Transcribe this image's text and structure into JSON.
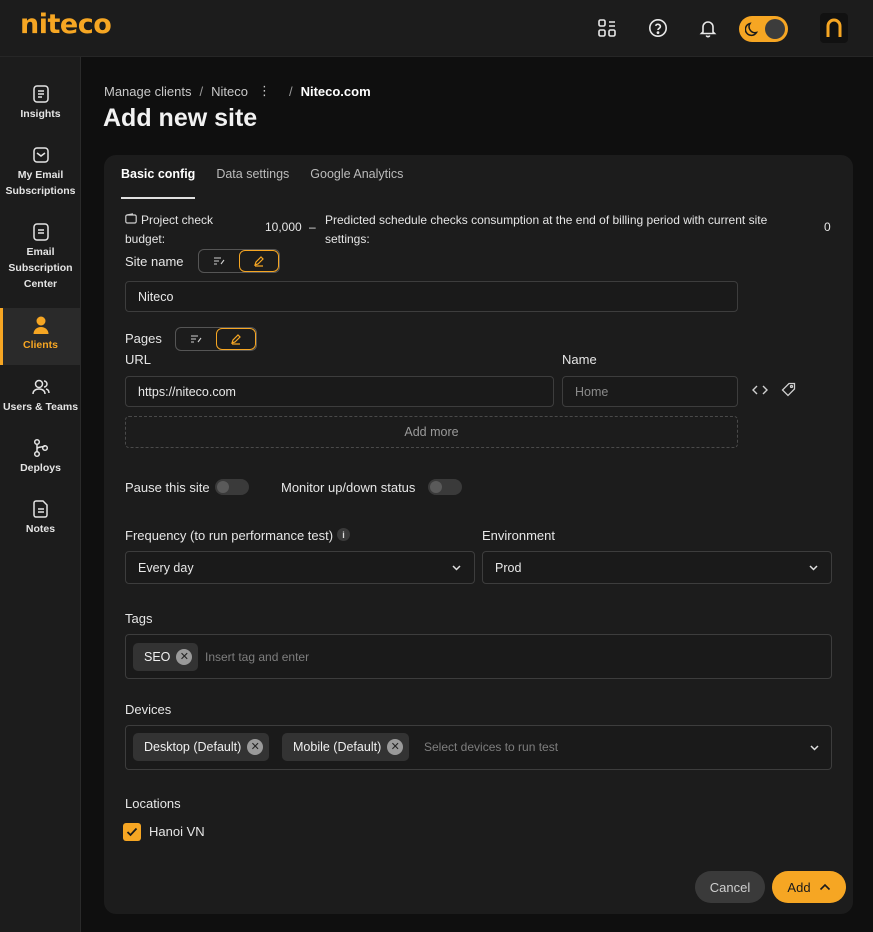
{
  "brand": {
    "logo": "niteco",
    "accent": "#f6a623"
  },
  "topbar": {
    "icons": [
      "apps-icon",
      "help-icon",
      "bell-icon",
      "theme-toggle",
      "avatar"
    ]
  },
  "sidebar": {
    "items": [
      {
        "label": "Insights",
        "icon": "insights-icon",
        "active": false
      },
      {
        "label": "My Email Subscriptions",
        "icon": "mail-icon",
        "active": false
      },
      {
        "label": "Email Subscription Center",
        "icon": "document-icon",
        "active": false
      },
      {
        "label": "Clients",
        "icon": "user-icon",
        "active": true
      },
      {
        "label": "Users & Teams",
        "icon": "users-icon",
        "active": false
      },
      {
        "label": "Deploys",
        "icon": "branch-icon",
        "active": false
      },
      {
        "label": "Notes",
        "icon": "note-icon",
        "active": false
      }
    ]
  },
  "breadcrumb": {
    "items": [
      "Manage clients",
      "Niteco",
      "Niteco.com"
    ]
  },
  "page": {
    "title": "Add new site"
  },
  "tabs": [
    "Basic config",
    "Data settings",
    "Google Analytics"
  ],
  "budget": {
    "label": "Project check budget:",
    "value": "10,000",
    "dash": "–",
    "predicted_label": "Predicted schedule checks consumption at the end of billing period with current site settings:",
    "predicted_value": "0"
  },
  "site_name": {
    "label": "Site name",
    "value": "Niteco"
  },
  "pages": {
    "label": "Pages",
    "url_label": "URL",
    "name_label": "Name",
    "url_value": "https://niteco.com",
    "name_placeholder": "Home",
    "add_more": "Add more"
  },
  "toggles": {
    "pause": "Pause this site",
    "monitor": "Monitor up/down status"
  },
  "frequency": {
    "label": "Frequency (to run performance test)",
    "value": "Every day"
  },
  "environment": {
    "label": "Environment",
    "value": "Prod"
  },
  "tags": {
    "label": "Tags",
    "chips": [
      "SEO"
    ],
    "placeholder": "Insert tag and enter"
  },
  "devices": {
    "label": "Devices",
    "chips": [
      "Desktop (Default)",
      "Mobile (Default)"
    ],
    "placeholder": "Select devices to run test"
  },
  "locations": {
    "label": "Locations",
    "items": [
      {
        "label": "Hanoi VN",
        "checked": true
      }
    ]
  },
  "actions": {
    "cancel": "Cancel",
    "add": "Add"
  }
}
